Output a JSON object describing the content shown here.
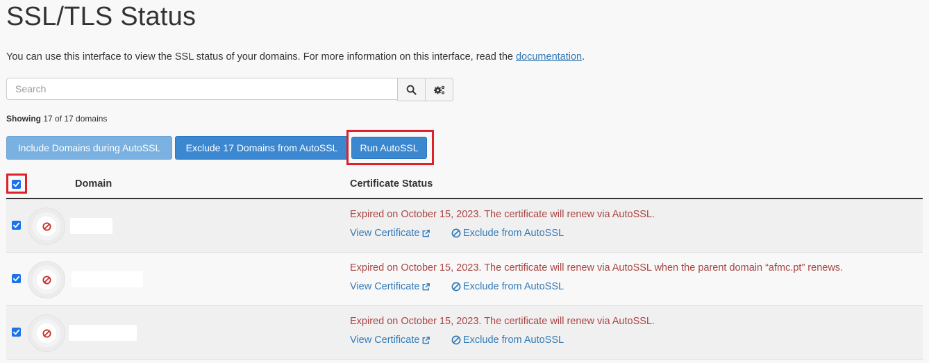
{
  "page": {
    "title": "SSL/TLS Status",
    "intro_text": "You can use this interface to view the SSL status of your domains. For more information on this interface, read the",
    "intro_link": "documentation",
    "intro_end": "."
  },
  "search": {
    "placeholder": "Search"
  },
  "showing": {
    "label": "Showing",
    "count_text": "17 of 17 domains"
  },
  "actions": {
    "include_label": "Include Domains during AutoSSL",
    "exclude_label": "Exclude 17 Domains from AutoSSL",
    "run_label": "Run AutoSSL"
  },
  "table": {
    "columns": [
      "Domain",
      "Certificate Status"
    ],
    "view_certificate_label": "View Certificate",
    "exclude_label": "Exclude from AutoSSL",
    "rows": [
      {
        "status": "Expired on October 15, 2023. The certificate will renew via AutoSSL."
      },
      {
        "status": "Expired on October 15, 2023. The certificate will renew via AutoSSL when the parent domain “afmc.pt” renews."
      },
      {
        "status": "Expired on October 15, 2023. The certificate will renew via AutoSSL."
      }
    ]
  },
  "colors": {
    "primary": "#3b87d0",
    "primary_light": "#7ab1e0",
    "error_text": "#a94442",
    "link": "#337ab7",
    "highlight": "#e0202a"
  }
}
